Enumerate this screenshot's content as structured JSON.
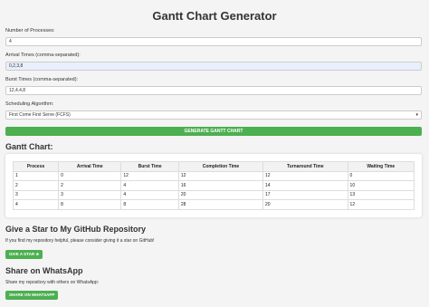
{
  "title": "Gantt Chart Generator",
  "form": {
    "num_processes_label": "Number of Processes:",
    "num_processes_value": "4",
    "arrival_label": "Arrival Times (comma-separated):",
    "arrival_value": "0,2,3,8",
    "burst_label": "Burst Times (comma-separated):",
    "burst_value": "12,4,4,8",
    "algorithm_label": "Scheduling Algorithm:",
    "algorithm_value": "First Come First Serve (FCFS)",
    "generate_label": "GENERATE GANTT CHART"
  },
  "gantt": {
    "heading": "Gantt Chart:",
    "columns": [
      "Process",
      "Arrival Time",
      "Burst Time",
      "Completion Time",
      "Turnaround Time",
      "Waiting Time"
    ],
    "rows": [
      [
        "1",
        "0",
        "12",
        "12",
        "12",
        "0"
      ],
      [
        "2",
        "2",
        "4",
        "16",
        "14",
        "10"
      ],
      [
        "3",
        "3",
        "4",
        "20",
        "17",
        "13"
      ],
      [
        "4",
        "8",
        "8",
        "28",
        "20",
        "12"
      ]
    ]
  },
  "github": {
    "heading": "Give a Star to My GitHub Repository",
    "text": "If you find my repository helpful, please consider giving it a star on GitHub!",
    "button": "GIVE A STAR ★"
  },
  "whatsapp": {
    "heading": "Share on WhatsApp",
    "text": "Share my repository with others on WhatsApp:",
    "button": "SHARE ON WHATSAPP"
  },
  "colors": {
    "accent": "#4caf50",
    "background": "#f4f4f4"
  }
}
